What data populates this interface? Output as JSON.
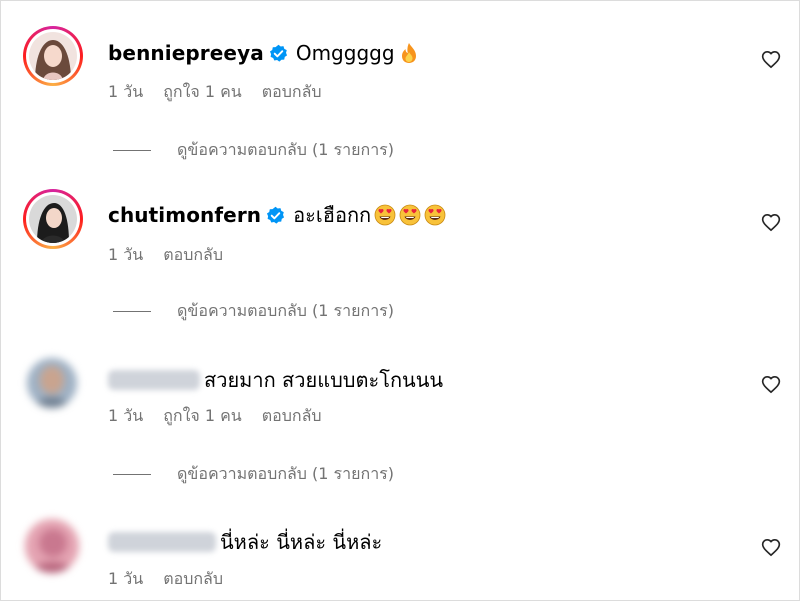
{
  "comments": [
    {
      "username": "benniepreeya",
      "verified": true,
      "text": "Omggggg",
      "emoji": [
        "fire-emoji"
      ],
      "time": "1 วัน",
      "likes": "ถูกใจ 1 คน",
      "reply": "ตอบกลับ",
      "view_replies": "ดูข้อความตอบกลับ (1 รายการ)"
    },
    {
      "username": "chutimonfern",
      "verified": true,
      "text": "อะเฮือกก",
      "emoji": [
        "heart-eyes-emoji",
        "heart-eyes-emoji",
        "heart-eyes-emoji"
      ],
      "time": "1 วัน",
      "reply": "ตอบกลับ",
      "view_replies": "ดูข้อความตอบกลับ (1 รายการ)"
    },
    {
      "username": "",
      "username_blurred": true,
      "text": "สวยมาก สวยแบบตะโกนนน",
      "time": "1 วัน",
      "likes": "ถูกใจ 1 คน",
      "reply": "ตอบกลับ",
      "view_replies": "ดูข้อความตอบกลับ (1 รายการ)"
    },
    {
      "username": "",
      "username_blurred": true,
      "text": "นี่หล่ะ นี่หล่ะ นี่หล่ะ",
      "time": "1 วัน",
      "reply": "ตอบกลับ"
    }
  ],
  "icons": {
    "like": "heart-outline-icon",
    "verified": "verified-badge-icon"
  },
  "colors": {
    "verified": "#0095f6",
    "meta_text": "#737373",
    "story_ring_start": "#d6249f",
    "story_ring_end": "#fcaf45"
  }
}
